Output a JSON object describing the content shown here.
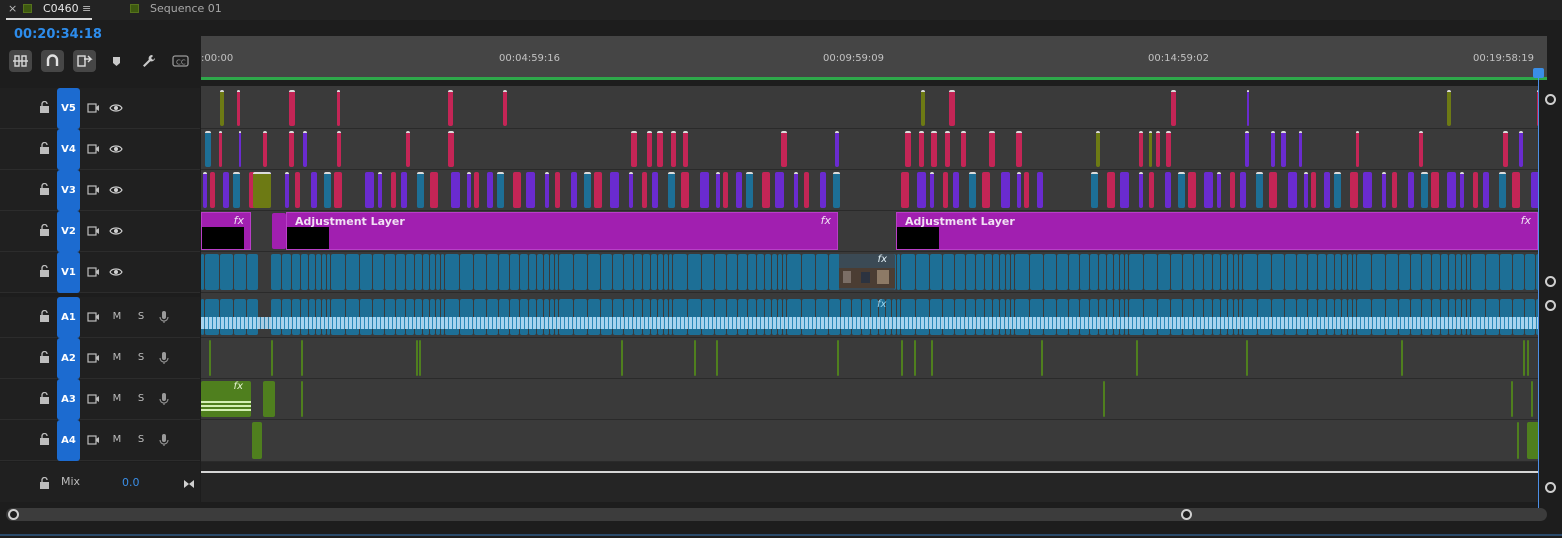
{
  "tabs": [
    {
      "close": "×",
      "name": "C0460",
      "menu": "≡"
    },
    {
      "name": "Sequence 01"
    }
  ],
  "timecode": "00:20:34:18",
  "ruler": {
    "ticks": [
      ":00:00",
      "00:04:59:16",
      "00:09:59:09",
      "00:14:59:02",
      "00:19:58:19"
    ]
  },
  "tracks": {
    "video": [
      {
        "id": "V5",
        "label": "V5"
      },
      {
        "id": "V4",
        "label": "V4"
      },
      {
        "id": "V3",
        "label": "V3"
      },
      {
        "id": "V2",
        "label": "V2"
      },
      {
        "id": "V1",
        "label": "V1"
      }
    ],
    "audio": [
      {
        "id": "A1",
        "label": "A1",
        "m": "M",
        "s": "S"
      },
      {
        "id": "A2",
        "label": "A2",
        "m": "M",
        "s": "S"
      },
      {
        "id": "A3",
        "label": "A3",
        "m": "M",
        "s": "S"
      },
      {
        "id": "A4",
        "label": "A4",
        "m": "M",
        "s": "S"
      }
    ],
    "mix": {
      "label": "Mix",
      "value": "0.0"
    }
  },
  "adjustment_layers": [
    {
      "label": "",
      "fx": "fx"
    },
    {
      "label": "Adjustment Layer",
      "fx": "fx"
    },
    {
      "label": "Adjustment Layer",
      "fx": "fx"
    }
  ],
  "clip_fx": {
    "v1": "fx",
    "a1": "fx",
    "a3": "fx"
  },
  "colors": {
    "accent": "#2d8ceb",
    "target": "#1c6bd0",
    "adjustment": "#a11fb0",
    "video_clip": "#1d6f96",
    "audio_clip": "#1d6f96",
    "red_clip": "#c42556",
    "violet_clip": "#6a2bd0",
    "olive_clip": "#6d7a14",
    "green_audio": "#4f7f1e",
    "playhead": "#3a8ee6",
    "timeline_bar": "#2ea84a"
  }
}
